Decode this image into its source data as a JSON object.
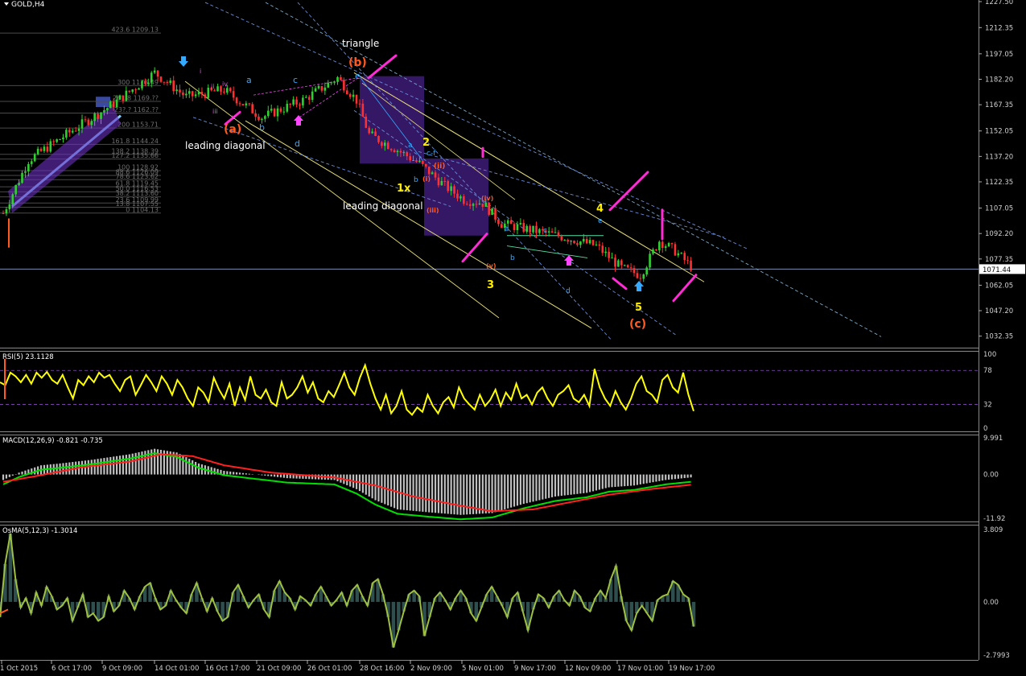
{
  "window": {
    "symbol_title": "GOLD,H4"
  },
  "colors": {
    "background": "#000000",
    "bull_candle": "#2fd12f",
    "bear_candle": "#ff3030",
    "rsi_line": "#ffff00",
    "macd_line": "#00e000",
    "macd_signal": "#ff2020",
    "macd_hist": "#c0c0c0",
    "osma_line": "#a0c040",
    "osma_hist": "#2f4f4f",
    "price_line": "#7e8bb0",
    "channel_yellow": "#e8e07a",
    "wave_cyan": "#33aaff",
    "wave_yellow": "#ffee00",
    "wave_orange": "#ff5a1f",
    "wave_magenta": "#ff44ff",
    "purple_box": "#3a1a70"
  },
  "chart_data": [
    {
      "type": "candlestick",
      "title": "GOLD,H4",
      "ylim": [
        1027.5,
        1227.5
      ],
      "y_ticks": [
        "1227.50",
        "1212.35",
        "1197.05",
        "1182.20",
        "1167.35",
        "1152.05",
        "1137.20",
        "1122.35",
        "1107.05",
        "1092.20",
        "1077.35",
        "1062.05",
        "1047.20",
        "1032.35"
      ],
      "x_ticks": [
        "1 Oct 2015",
        "6 Oct 17:00",
        "9 Oct 09:00",
        "14 Oct 01:00",
        "16 Oct 17:00",
        "21 Oct 09:00",
        "26 Oct 01:00",
        "28 Oct 16:00",
        "2 Nov 09:00",
        "5 Nov 01:00",
        "9 Nov 17:00",
        "12 Nov 09:00",
        "17 Nov 01:00",
        "19 Nov 17:00"
      ],
      "current_price": "1071.44",
      "close_path": [
        [
          0,
          1104
        ],
        [
          8,
          1135
        ],
        [
          20,
          1150
        ],
        [
          35,
          1168
        ],
        [
          48,
          1186
        ],
        [
          58,
          1172
        ],
        [
          70,
          1176
        ],
        [
          82,
          1160
        ],
        [
          95,
          1170
        ],
        [
          106,
          1183
        ],
        [
          112,
          1170
        ],
        [
          116,
          1150
        ],
        [
          124,
          1142
        ],
        [
          132,
          1133
        ],
        [
          140,
          1120
        ],
        [
          146,
          1112
        ],
        [
          152,
          1110
        ],
        [
          158,
          1098
        ],
        [
          168,
          1094
        ],
        [
          178,
          1090
        ],
        [
          188,
          1085
        ],
        [
          196,
          1072
        ],
        [
          202,
          1068
        ],
        [
          208,
          1088
        ],
        [
          213,
          1082
        ],
        [
          218,
          1073
        ]
      ],
      "fib_levels": [
        "423.6 1209.13",
        "300 1178.49",
        "261.8 1169.??",
        "23?.? 1162.??",
        "200 1153.71",
        "161.8 1144.24",
        "138.2 1138.39",
        "127.2 1135.66",
        "100 1128.92",
        "88.6 1126.09",
        "78.6 1123.62",
        "61.8 1119.45",
        "50.0 1116.53",
        "38.2 1113.60",
        "23.6 1109.99",
        "13.8 1107.55",
        "0 1104.13"
      ],
      "wave_labels": [
        {
          "text": "triangle",
          "color": "white"
        },
        {
          "text": "(b)",
          "color": "orange"
        },
        {
          "text": "e",
          "color": "cyan"
        },
        {
          "text": "a",
          "color": "cyan"
        },
        {
          "text": "c",
          "color": "cyan"
        },
        {
          "text": "(a)",
          "color": "orange"
        },
        {
          "text": "b",
          "color": "cyan"
        },
        {
          "text": "d",
          "color": "cyan"
        },
        {
          "text": "leading diagonal",
          "color": "white"
        },
        {
          "text": "2",
          "color": "yellow"
        },
        {
          "text": "1x",
          "color": "yellow"
        },
        {
          "text": "leading diagonal",
          "color": "white"
        },
        {
          "text": "3",
          "color": "yellow"
        },
        {
          "text": "4",
          "color": "yellow"
        },
        {
          "text": "5",
          "color": "yellow"
        },
        {
          "text": "(c)",
          "color": "orange"
        },
        {
          "text": "a",
          "color": "cyan"
        },
        {
          "text": "b",
          "color": "cyan"
        },
        {
          "text": "c",
          "color": "cyan"
        },
        {
          "text": "d",
          "color": "cyan"
        },
        {
          "text": "e",
          "color": "cyan"
        },
        {
          "text": "a",
          "color": "cyan"
        },
        {
          "text": "b",
          "color": "cyan"
        },
        {
          "text": "c-f",
          "color": "cyan"
        },
        {
          "text": "(ii)",
          "color": "orange"
        },
        {
          "text": "(iv)",
          "color": "orange"
        },
        {
          "text": "(v)",
          "color": "orange"
        },
        {
          "text": "(iii)",
          "color": "orange"
        },
        {
          "text": "(i)",
          "color": "orange"
        },
        {
          "text": "i",
          "color": "magenta"
        },
        {
          "text": "ii",
          "color": "magenta"
        },
        {
          "text": "iii",
          "color": "magenta"
        },
        {
          "text": "iv",
          "color": "magenta"
        },
        {
          "text": "v",
          "color": "magenta"
        }
      ]
    },
    {
      "type": "line",
      "title": "RSI(5) 23.1128",
      "ylim": [
        0,
        100
      ],
      "y_ticks": [
        "100",
        "78",
        "32",
        "0"
      ],
      "levels": [
        78,
        32
      ],
      "series": [
        {
          "values": [
            62,
            58,
            75,
            70,
            62,
            72,
            60,
            75,
            68,
            76,
            65,
            60,
            72,
            55,
            40,
            65,
            58,
            70,
            62,
            75,
            68,
            72,
            60,
            50,
            65,
            70,
            45,
            58,
            72,
            62,
            50,
            70,
            60,
            45,
            65,
            55,
            40,
            30,
            55,
            48,
            35,
            68,
            52,
            40,
            60,
            30,
            55,
            38,
            70,
            45,
            40,
            52,
            35,
            30,
            62,
            40,
            45,
            55,
            70,
            48,
            62,
            40,
            35,
            50,
            42,
            58,
            75,
            55,
            45,
            68,
            85,
            60,
            40,
            25,
            45,
            20,
            30,
            50,
            25,
            18,
            28,
            22,
            45,
            30,
            20,
            35,
            42,
            28,
            55,
            40,
            32,
            25,
            45,
            30,
            38,
            52,
            30,
            48,
            38,
            60,
            40,
            45,
            32,
            48,
            55,
            40,
            30,
            45,
            50,
            58,
            40,
            35,
            45,
            30,
            80,
            55,
            40,
            30,
            50,
            35,
            25,
            40,
            60,
            70,
            50,
            45,
            35,
            65,
            72,
            55,
            48,
            75,
            45,
            23
          ]
        }
      ]
    },
    {
      "type": "bar",
      "title": "MACD(12,26,9) -0.821 -0.735",
      "ylim": [
        -11.92,
        9.991
      ],
      "y_ticks": [
        "9.991",
        "0.00",
        "-11.92"
      ],
      "series": [
        {
          "name": "MACD",
          "path": [
            [
              0,
              -1.5
            ],
            [
              5,
              0.5
            ],
            [
              12,
              2.5
            ],
            [
              18,
              3
            ],
            [
              28,
              4
            ],
            [
              40,
              5.5
            ],
            [
              48,
              7
            ],
            [
              55,
              6
            ],
            [
              62,
              3
            ],
            [
              70,
              1
            ],
            [
              80,
              0
            ],
            [
              90,
              -1
            ],
            [
              105,
              -1.5
            ],
            [
              112,
              -4
            ],
            [
              118,
              -7
            ],
            [
              125,
              -9.5
            ],
            [
              135,
              -10.3
            ],
            [
              145,
              -11
            ],
            [
              155,
              -10.5
            ],
            [
              165,
              -8
            ],
            [
              175,
              -6
            ],
            [
              185,
              -5
            ],
            [
              192,
              -3.5
            ],
            [
              200,
              -3
            ],
            [
              210,
              -1.5
            ],
            [
              218,
              -0.8
            ]
          ]
        },
        {
          "name": "Signal",
          "path": [
            [
              0,
              -2
            ],
            [
              10,
              -0.5
            ],
            [
              25,
              2
            ],
            [
              40,
              3.5
            ],
            [
              50,
              5.5
            ],
            [
              60,
              5
            ],
            [
              70,
              2.5
            ],
            [
              85,
              0.5
            ],
            [
              105,
              -0.8
            ],
            [
              118,
              -3
            ],
            [
              130,
              -6
            ],
            [
              145,
              -8.5
            ],
            [
              155,
              -10
            ],
            [
              168,
              -9.5
            ],
            [
              180,
              -7.5
            ],
            [
              192,
              -5.5
            ],
            [
              205,
              -4
            ],
            [
              218,
              -2.8
            ]
          ]
        }
      ]
    },
    {
      "type": "bar",
      "title": "OsMA(5,12,3) -1.3014",
      "ylim": [
        -2.7993,
        3.809
      ],
      "y_ticks": [
        "3.809",
        "0.00",
        "-2.7993"
      ],
      "series": [
        {
          "values": [
            -0.8,
            2,
            3.6,
            1.2,
            -0.3,
            0.2,
            -0.6,
            0.5,
            -0.2,
            0.8,
            0.3,
            -0.4,
            -0.2,
            0.2,
            -1,
            -0.3,
            0.4,
            -0.8,
            -0.6,
            -1,
            -0.8,
            0.3,
            -0.5,
            -0.2,
            0.6,
            0.2,
            -0.4,
            0.3,
            0.8,
            1,
            0.2,
            -0.4,
            -0.2,
            0.6,
            0.1,
            -0.3,
            -0.6,
            0.4,
            1,
            0.2,
            -0.5,
            0.2,
            -0.5,
            -1,
            -0.8,
            0.5,
            0.9,
            0.3,
            -0.3,
            0.1,
            0.4,
            -0.4,
            -0.8,
            0.6,
            1.1,
            0.5,
            0.2,
            -0.4,
            0.3,
            0.1,
            -0.2,
            0.4,
            0.8,
            0.3,
            -0.2,
            0.1,
            0.5,
            -0.2,
            0.6,
            0.9,
            0.3,
            -0.2,
            1,
            1.2,
            0.4,
            -0.8,
            -2.4,
            -1.5,
            -0.5,
            0.4,
            0.6,
            0.3,
            -1.8,
            -0.8,
            0.2,
            0.5,
            0.1,
            -0.4,
            0.2,
            0.6,
            0.2,
            -0.6,
            -1,
            -0.3,
            0.4,
            0.8,
            0.3,
            -0.2,
            -0.8,
            0.2,
            0.5,
            -0.5,
            -1.5,
            -0.4,
            0.4,
            0.2,
            -0.3,
            0.3,
            0.6,
            0.1,
            -0.2,
            0.6,
            0.3,
            -0.3,
            -0.5,
            0.2,
            0.6,
            0.2,
            1.2,
            1.9,
            0.3,
            -1,
            -1.5,
            -0.6,
            -0.2,
            -0.6,
            -1,
            0.1,
            0.3,
            0.4,
            1.1,
            0.9,
            0.4,
            0.2,
            -1.3
          ]
        }
      ]
    }
  ]
}
